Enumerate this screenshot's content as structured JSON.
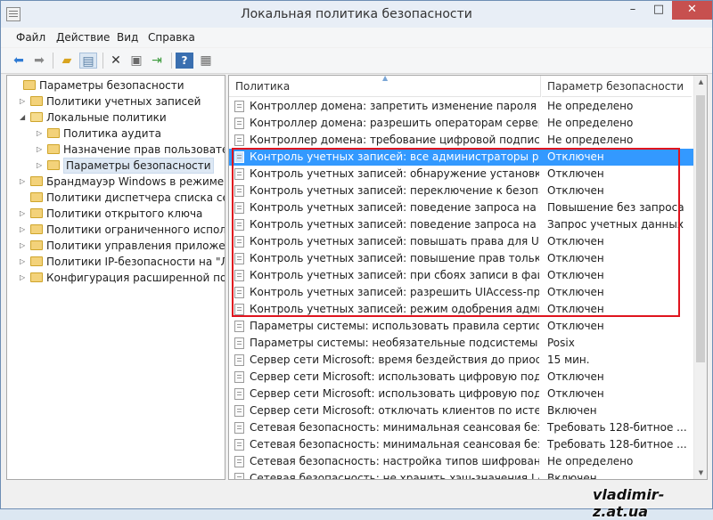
{
  "window": {
    "title": "Локальная политика безопасности"
  },
  "window_buttons": {
    "minimize": "–",
    "maximize": "□",
    "close": "✕"
  },
  "menu": [
    "Файл",
    "Действие",
    "Вид",
    "Справка"
  ],
  "toolbar_icons": [
    "back-icon",
    "forward-icon",
    "up-folder-icon",
    "show-tree-icon",
    "delete-icon",
    "properties-icon",
    "export-icon",
    "help-icon",
    "console-icon"
  ],
  "tree": [
    {
      "label": "Параметры безопасности",
      "level": 0,
      "twisty": ""
    },
    {
      "label": "Политики учетных записей",
      "level": 1,
      "twisty": "▷"
    },
    {
      "label": "Локальные политики",
      "level": 1,
      "twisty": "◢"
    },
    {
      "label": "Политика аудита",
      "level": 2,
      "twisty": "▷"
    },
    {
      "label": "Назначение прав пользователя",
      "level": 2,
      "twisty": "▷"
    },
    {
      "label": "Параметры безопасности",
      "level": 2,
      "twisty": "▷",
      "selected": true
    },
    {
      "label": "Брандмауэр Windows в режиме пов",
      "level": 1,
      "twisty": "▷"
    },
    {
      "label": "Политики диспетчера списка сетей",
      "level": 1,
      "twisty": ""
    },
    {
      "label": "Политики открытого ключа",
      "level": 1,
      "twisty": "▷"
    },
    {
      "label": "Политики ограниченного использо",
      "level": 1,
      "twisty": "▷"
    },
    {
      "label": "Политики управления приложения",
      "level": 1,
      "twisty": "▷"
    },
    {
      "label": "Политики IP-безопасности на \"Лока",
      "level": 1,
      "twisty": "▷"
    },
    {
      "label": "Конфигурация расширенной полит",
      "level": 1,
      "twisty": "▷"
    }
  ],
  "columns": {
    "policy": "Политика",
    "setting": "Параметр безопасности"
  },
  "rows": [
    {
      "name": "Контроллер домена: запретить изменение пароля учетн...",
      "value": "Не определено"
    },
    {
      "name": "Контроллер домена: разрешить операторам сервера зад...",
      "value": "Не определено"
    },
    {
      "name": "Контроллер домена: требование цифровой подписи для ...",
      "value": "Не определено"
    },
    {
      "name": "Контроль учетных записей: все администраторы работа...",
      "value": "Отключен",
      "selected": true
    },
    {
      "name": "Контроль учетных записей: обнаружение установки при...",
      "value": "Отключен"
    },
    {
      "name": "Контроль учетных записей: переключение к безопасном...",
      "value": "Отключен"
    },
    {
      "name": "Контроль учетных записей: поведение запроса на повы...",
      "value": "Повышение без запроса"
    },
    {
      "name": "Контроль учетных записей: поведение запроса на повы...",
      "value": "Запрос учетных данных"
    },
    {
      "name": "Контроль учетных записей: повышать права для UIAcces...",
      "value": "Отключен"
    },
    {
      "name": "Контроль учетных записей: повышение прав только для ...",
      "value": "Отключен"
    },
    {
      "name": "Контроль учетных записей: при сбоях записи в файл или...",
      "value": "Отключен"
    },
    {
      "name": "Контроль учетных записей: разрешить UIAccess-прилож...",
      "value": "Отключен"
    },
    {
      "name": "Контроль учетных записей: режим одобрения админист...",
      "value": "Отключен"
    },
    {
      "name": "Параметры системы: использовать правила сертификат...",
      "value": "Отключен"
    },
    {
      "name": "Параметры системы: необязательные подсистемы",
      "value": "Posix"
    },
    {
      "name": "Сервер сети Microsoft: время бездействия до приостанов...",
      "value": "15 мин."
    },
    {
      "name": "Сервер сети Microsoft: использовать цифровую подпись ...",
      "value": "Отключен"
    },
    {
      "name": "Сервер сети Microsoft: использовать цифровую подпись ...",
      "value": "Отключен"
    },
    {
      "name": "Сервер сети Microsoft: отключать клиентов по истечени...",
      "value": "Включен"
    },
    {
      "name": "Сетевая безопасность: минимальная сеансовая безопасн...",
      "value": "Требовать 128-битное ..."
    },
    {
      "name": "Сетевая безопасность: минимальная сеансовая безопасн...",
      "value": "Требовать 128-битное ..."
    },
    {
      "name": "Сетевая безопасность: настройка типов шифрования, ра...",
      "value": "Не определено"
    },
    {
      "name": "Сетевая безопасность: не хранить хэш-значения LAN Ma...",
      "value": "Включен"
    }
  ],
  "watermark": "vladimir-z.at.ua",
  "colors": {
    "selection": "#3399ff",
    "highlight_border": "#e0141e",
    "close_button": "#c7504f"
  }
}
